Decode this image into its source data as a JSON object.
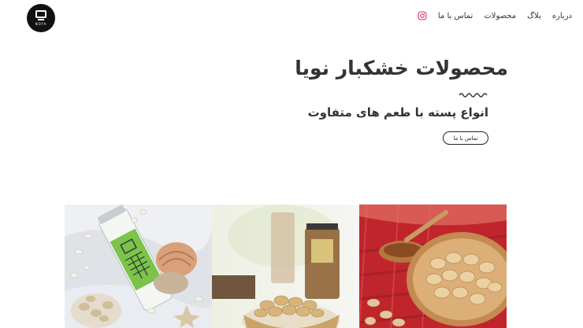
{
  "brand": {
    "logo_text": "NOYA"
  },
  "nav": {
    "items": [
      {
        "label": "تماس با ما"
      },
      {
        "label": "محصولات"
      },
      {
        "label": "بلاگ"
      },
      {
        "label": "درباره"
      }
    ],
    "instagram_icon": "instagram-icon"
  },
  "hero": {
    "title": "محصولات خشکبار نویا",
    "subtitle": "انواع پسته با طعم های متفاوت",
    "cta_label": "تماس با ما"
  },
  "gallery": {
    "photos": [
      {
        "name": "pistachio-jar-on-sand"
      },
      {
        "name": "pistachios-bowl-with-jars"
      },
      {
        "name": "pistachios-on-red-cloth"
      }
    ]
  },
  "colors": {
    "accent_instagram": "#e1306c",
    "text": "#333333",
    "jar_label": "#7dc24b",
    "cloth_red": "#c0252c"
  }
}
